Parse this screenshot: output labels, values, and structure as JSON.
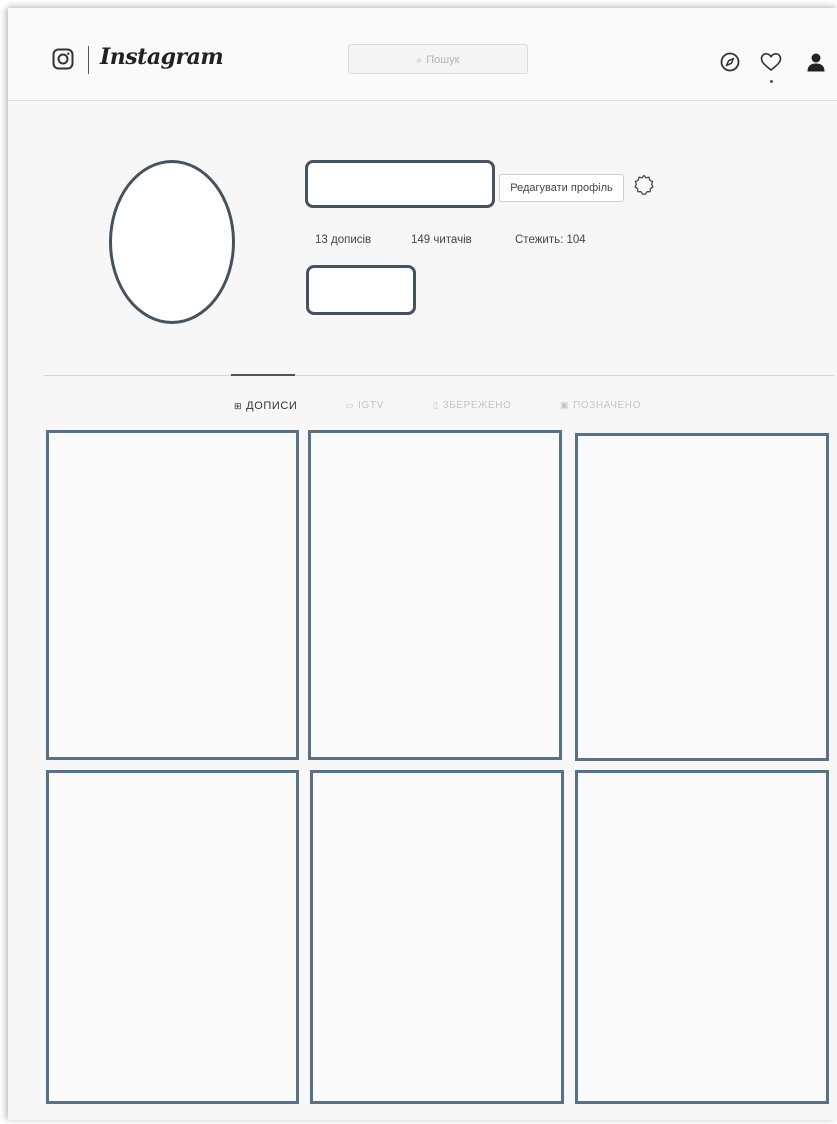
{
  "header": {
    "brand": "Instagram",
    "search_placeholder": "Пошук",
    "icons": [
      "instagram-logo-icon",
      "search-icon",
      "compass-icon",
      "heart-icon",
      "person-icon"
    ]
  },
  "profile": {
    "edit_button": "Редагувати профіль",
    "posts": "13 дописів",
    "followers": "149 читачів",
    "following": "Стежить: 104",
    "icons": [
      "settings-gear-icon"
    ]
  },
  "tabs": [
    {
      "label": "ДОПИСИ",
      "active": true,
      "icon": "grid-icon"
    },
    {
      "label": "IGTV",
      "active": false,
      "icon": "igtv-icon"
    },
    {
      "label": "ЗБЕРЕЖЕНО",
      "active": false,
      "icon": "bookmark-icon"
    },
    {
      "label": "ПОЗНАЧЕНО",
      "active": false,
      "icon": "tag-icon"
    }
  ],
  "colors": {
    "outline": "#46525e",
    "post_border": "#5a7185",
    "inactive_tab": "#c4c4c4"
  }
}
